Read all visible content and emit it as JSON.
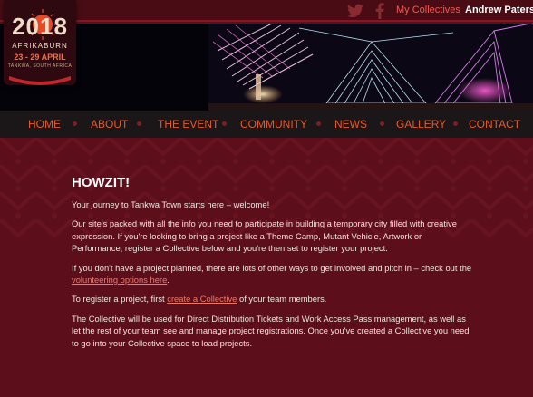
{
  "topbar": {
    "twitter_icon": "twitter-icon",
    "facebook_icon": "facebook-icon",
    "my_collectives": "My Collectives",
    "user_name": "Andrew Paterson"
  },
  "logo": {
    "year": "2018",
    "brand": "AFRIKABURN",
    "dates": "23 - 29 APRIL",
    "place": "TANKWA, SOUTH AFRICA"
  },
  "nav": {
    "items": [
      "HOME",
      "ABOUT",
      "THE EVENT",
      "COMMUNITY",
      "NEWS",
      "GALLERY",
      "CONTACT"
    ]
  },
  "content": {
    "heading": "HOWZIT!",
    "p1": "Your journey to Tankwa Town starts here – welcome!",
    "p2": "Our site's packed with all the info you need to participate in building a temporary city filled with creative expression. If you're looking to bring a project like a Theme Camp, Mutant Vehicle, Artwork or Performance, register a Collective below and you're then set to register your project.",
    "p3_before": "If you don't have a project planned, there are lots of other ways to get involved and pitch in – check out the ",
    "p3_link": "volunteering options here",
    "p3_after": ".",
    "p4_before": "To register a project, first ",
    "p4_link": "create a Collective",
    "p4_after": " of your team members.",
    "p5": "The Collective will be used for Direct Distribution Tickets and Work Access Pass management, as well as let the rest of your team see and manage project registrations. Once you've created a Collective you need to go into your Collective space to load projects."
  },
  "colors": {
    "background": "#5c0f1a",
    "nav_text": "#e8582a",
    "link": "#f07868",
    "accent": "#f05a50"
  }
}
